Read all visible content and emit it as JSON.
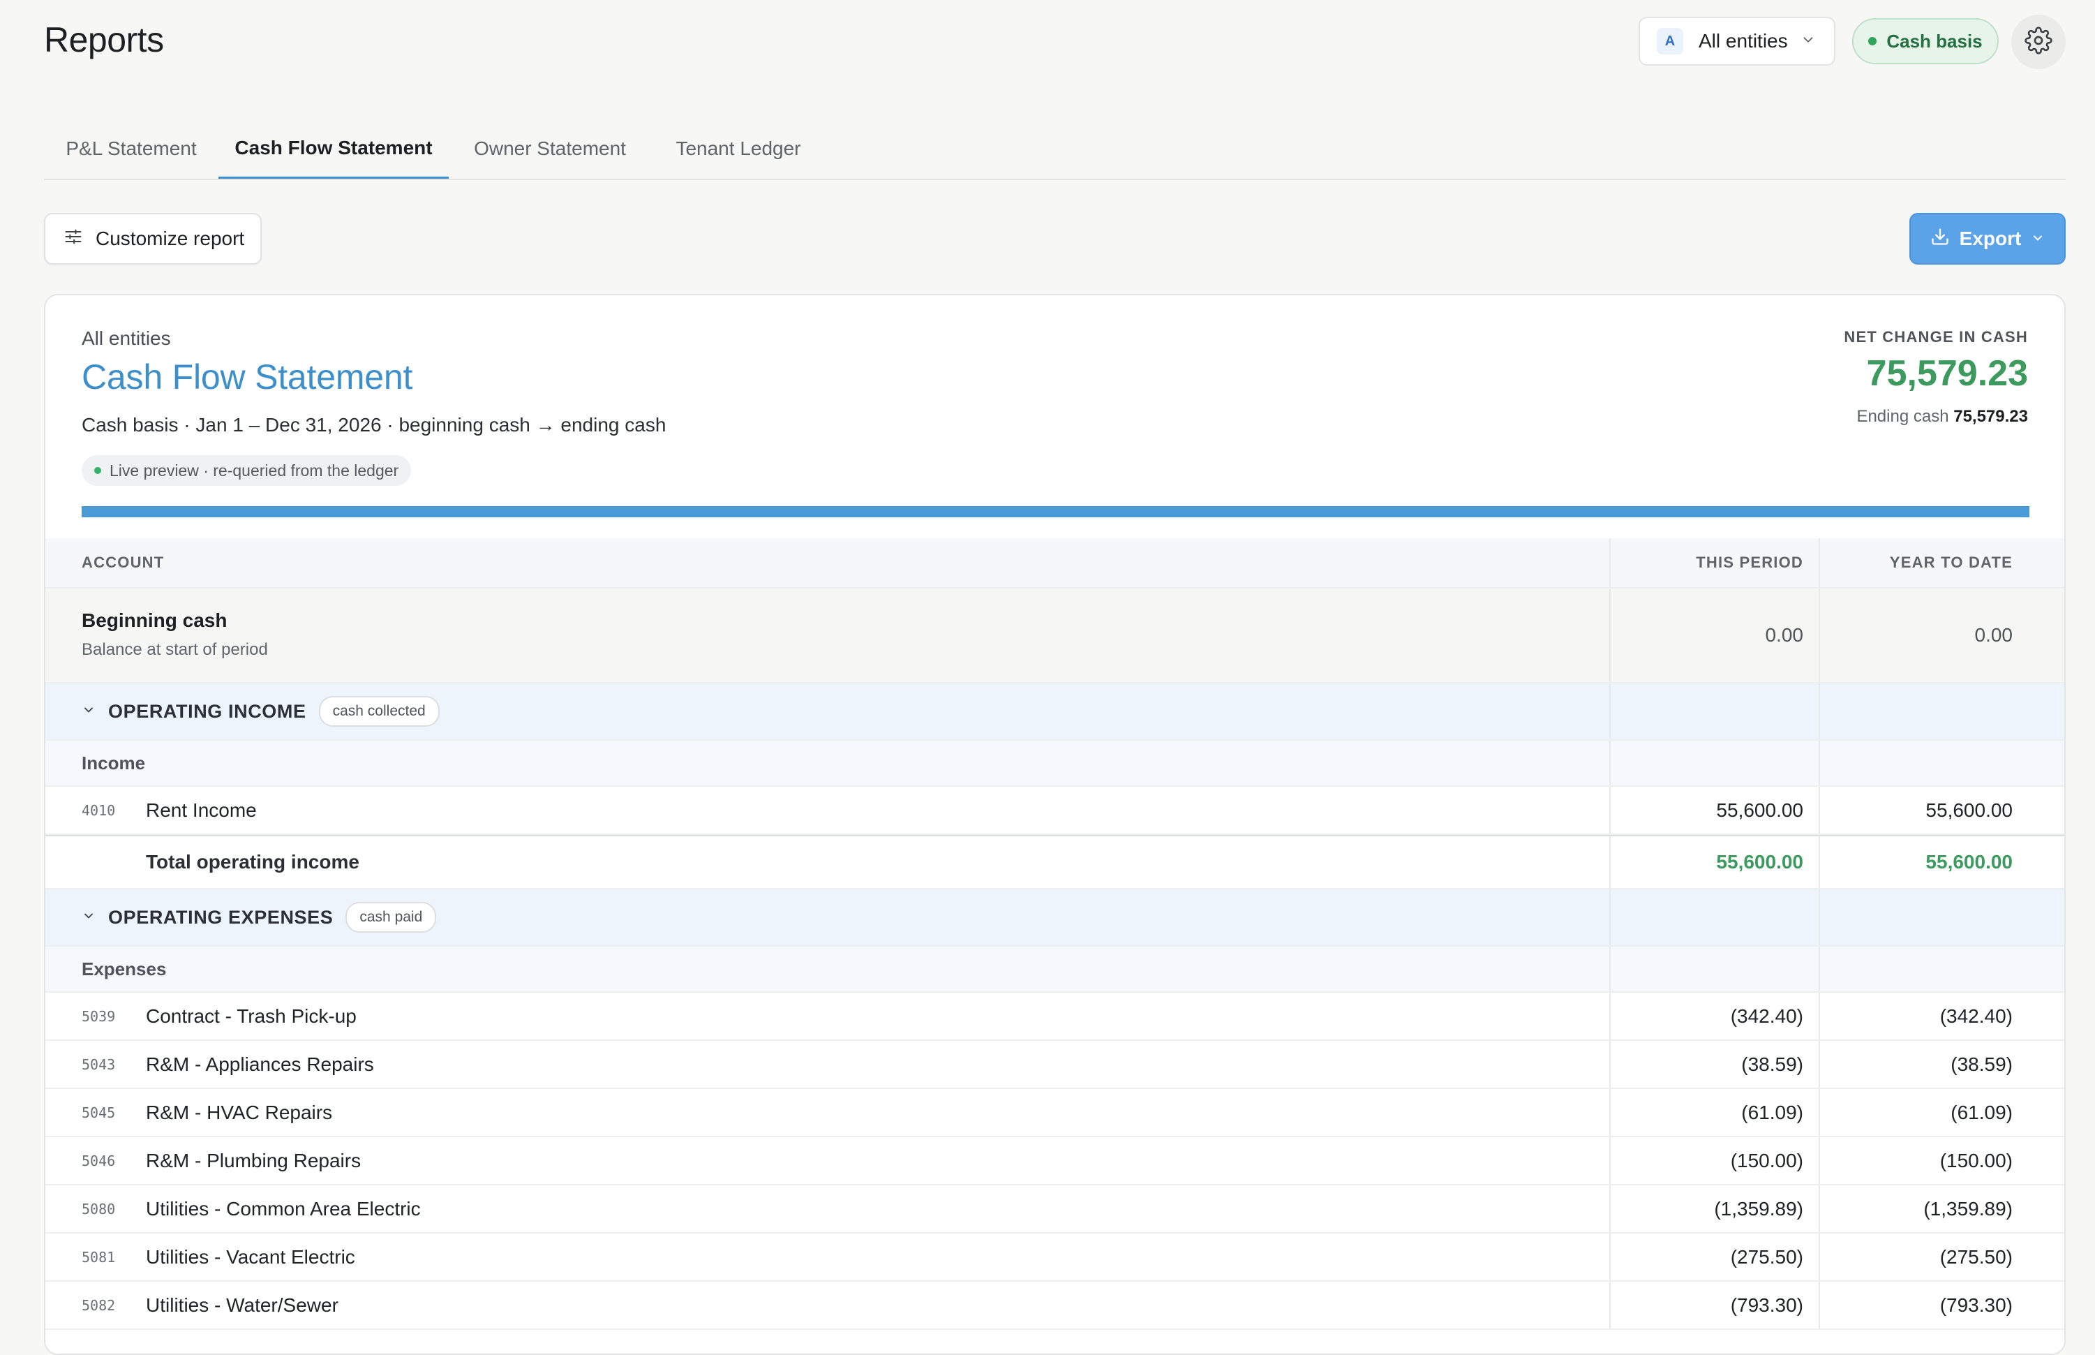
{
  "header": {
    "title": "Reports",
    "entity_selector": {
      "avatar": "A",
      "label": "All entities"
    },
    "basis_badge": "Cash basis"
  },
  "tabs": [
    {
      "label": "P&L Statement",
      "active": false
    },
    {
      "label": "Cash Flow Statement",
      "active": true
    },
    {
      "label": "Owner Statement",
      "active": false
    },
    {
      "label": "Tenant Ledger",
      "active": false
    }
  ],
  "toolbar": {
    "customize_label": "Customize report",
    "export_label": "Export"
  },
  "report": {
    "entity": "All entities",
    "title": "Cash Flow Statement",
    "meta": "Cash basis · Jan 1 – Dec 31, 2026 · beginning cash → ending cash",
    "live_chip": "Live preview · re-queried from the ledger",
    "net_change_label": "NET CHANGE IN CASH",
    "net_change_value": "75,579.23",
    "ending_cash_label": "Ending cash",
    "ending_cash_value": "75,579.23",
    "progress_fraction": 1.0
  },
  "table": {
    "columns": {
      "account": "ACCOUNT",
      "period": "THIS PERIOD",
      "ytd": "YEAR TO DATE"
    },
    "beginning": {
      "title": "Beginning cash",
      "subtitle": "Balance at start of period",
      "period": "0.00",
      "ytd": "0.00"
    },
    "income_section": {
      "title": "OPERATING INCOME",
      "chip": "cash collected",
      "group": "Income",
      "lines": [
        {
          "code": "4010",
          "name": "Rent Income",
          "period": "55,600.00",
          "ytd": "55,600.00"
        }
      ],
      "total": {
        "label": "Total operating income",
        "period": "55,600.00",
        "ytd": "55,600.00"
      }
    },
    "expense_section": {
      "title": "OPERATING EXPENSES",
      "chip": "cash paid",
      "group": "Expenses",
      "lines": [
        {
          "code": "5039",
          "name": "Contract - Trash Pick-up",
          "period": "(342.40)",
          "ytd": "(342.40)"
        },
        {
          "code": "5043",
          "name": "R&M - Appliances Repairs",
          "period": "(38.59)",
          "ytd": "(38.59)"
        },
        {
          "code": "5045",
          "name": "R&M - HVAC Repairs",
          "period": "(61.09)",
          "ytd": "(61.09)"
        },
        {
          "code": "5046",
          "name": "R&M - Plumbing Repairs",
          "period": "(150.00)",
          "ytd": "(150.00)"
        },
        {
          "code": "5080",
          "name": "Utilities - Common Area Electric",
          "period": "(1,359.89)",
          "ytd": "(1,359.89)"
        },
        {
          "code": "5081",
          "name": "Utilities - Vacant Electric",
          "period": "(275.50)",
          "ytd": "(275.50)"
        },
        {
          "code": "5082",
          "name": "Utilities - Water/Sewer",
          "period": "(793.30)",
          "ytd": "(793.30)"
        }
      ]
    }
  },
  "icons": {
    "entity_chevron": "chevron-down-icon",
    "basis_dot": "status-dot-icon",
    "settings": "gear-icon",
    "customize": "sliders-icon",
    "export": "download-icon",
    "export_chevron": "chevron-down-icon",
    "section_toggle": "chevron-down-icon"
  },
  "colors": {
    "accent": "#4a9ad8",
    "positive": "#3c9a5f",
    "basis_badge_bg": "#e6f4ea",
    "section_bg": "#eef4fb"
  }
}
